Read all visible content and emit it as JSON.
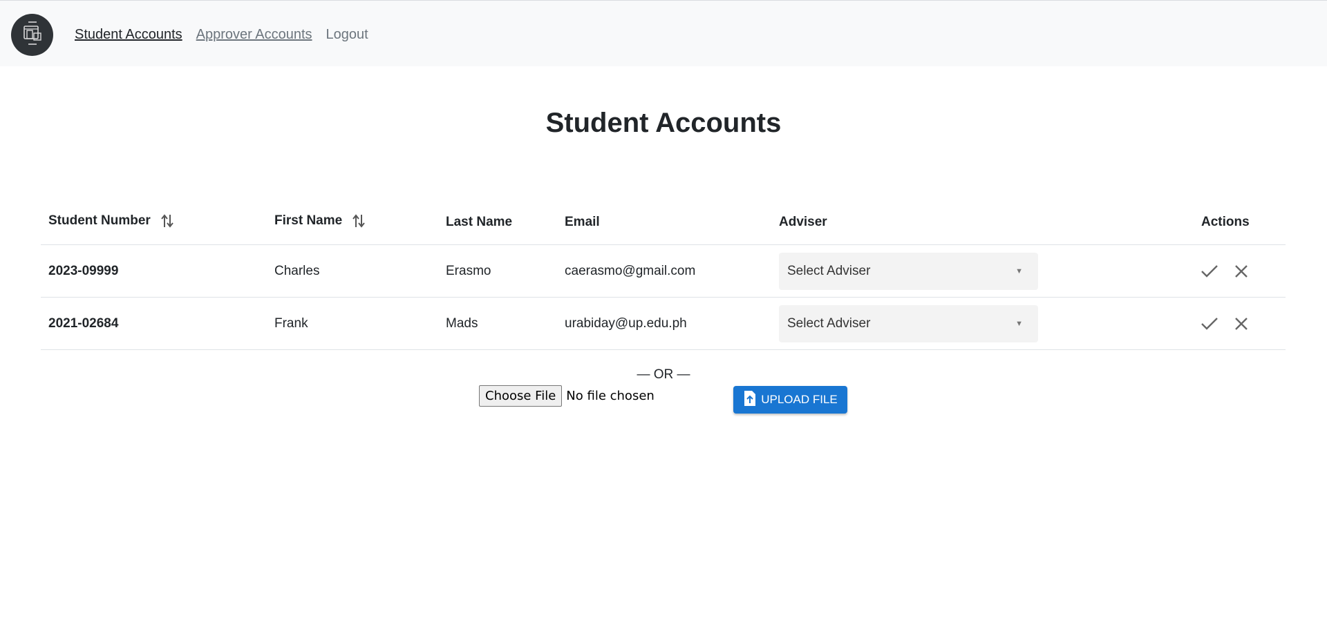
{
  "nav": {
    "logo_icon": "document-devices-icon",
    "links": [
      {
        "label": "Student Accounts"
      },
      {
        "label": "Approver Accounts"
      },
      {
        "label": "Logout"
      }
    ]
  },
  "page": {
    "title": "Student Accounts"
  },
  "table": {
    "headers": {
      "student_number": "Student Number",
      "first_name": "First Name",
      "last_name": "Last Name",
      "email": "Email",
      "adviser": "Adviser",
      "actions": "Actions"
    },
    "rows": [
      {
        "student_number": "2023-09999",
        "first_name": "Charles",
        "last_name": "Erasmo",
        "email": "caerasmo@gmail.com",
        "adviser_placeholder": "Select Adviser"
      },
      {
        "student_number": "2021-02684",
        "first_name": "Frank",
        "last_name": "Mads",
        "email": "urabiday@up.edu.ph",
        "adviser_placeholder": "Select Adviser"
      }
    ]
  },
  "upload": {
    "or_text": "— OR —",
    "choose_label": "Choose File",
    "file_status": "No file chosen",
    "upload_label": "UPLOAD FILE"
  },
  "colors": {
    "primary": "#1976d2",
    "navbar_bg": "#f8f9fa"
  }
}
